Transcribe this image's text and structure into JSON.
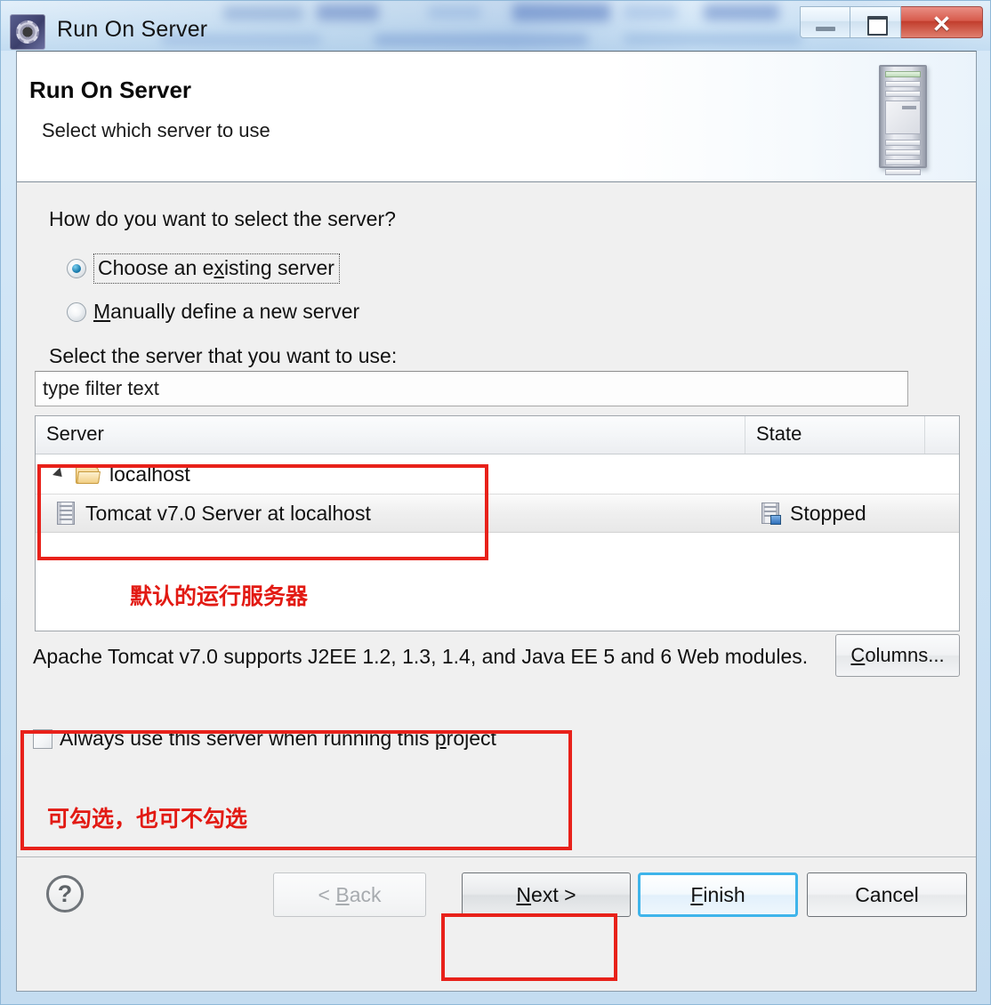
{
  "window": {
    "title": "Run On Server",
    "app_icon": "gear-icon",
    "controls": {
      "minimize": "minimize-icon",
      "maximize": "maximize-icon",
      "close": "✕"
    }
  },
  "header": {
    "title": "Run On Server",
    "subtitle": "Select which server to use",
    "graphic": "server-tower-icon"
  },
  "content": {
    "question": "How do you want to select the server?",
    "radios": [
      {
        "label_pre": "Choose an e",
        "mnemonic": "x",
        "label_post": "isting server",
        "checked": true,
        "focused": true
      },
      {
        "label_pre": "",
        "mnemonic": "M",
        "label_post": "anually define a new server",
        "checked": false,
        "focused": false
      }
    ],
    "select_label": "Select the server that you want to use:",
    "filter": {
      "value": "type filter text",
      "placeholder": "type filter text"
    },
    "tree": {
      "columns": [
        "Server",
        "State",
        ""
      ],
      "rows": [
        {
          "name": "localhost",
          "state": "",
          "icon": "folder-open-icon",
          "level": 0,
          "expanded": true,
          "selected": false
        },
        {
          "name": "Tomcat v7.0 Server at localhost",
          "state": "Stopped",
          "icon": "server-icon",
          "state_icon": "server-stopped-icon",
          "level": 1,
          "expanded": false,
          "selected": true
        }
      ]
    },
    "description": "Apache Tomcat v7.0 supports J2EE 1.2, 1.3, 1.4, and Java EE 5 and 6 Web modules.",
    "columns_button": {
      "mnemonic": "C",
      "label_post": "olumns..."
    },
    "checkbox": {
      "checked": false,
      "label_pre": "Always use this server when running this ",
      "mnemonic": "p",
      "label_post": "roject"
    }
  },
  "annotations": [
    {
      "id": "default-server",
      "text": "默认的运行服务器",
      "color": "#e21a13"
    },
    {
      "id": "checkbox-optional",
      "text": "可勾选，也可不勾选",
      "color": "#e21a13"
    }
  ],
  "highlight_boxes": [
    {
      "id": "tree-highlight",
      "target": "server-tree-rows",
      "color": "#e8211a"
    },
    {
      "id": "checkbox-highlight",
      "target": "always-use-checkbox",
      "color": "#e8211a"
    },
    {
      "id": "next-highlight",
      "target": "next-button",
      "color": "#e8211a"
    }
  ],
  "footer": {
    "help": "?",
    "buttons": [
      {
        "id": "back",
        "pre": "< ",
        "mnemonic": "B",
        "post": "ack",
        "enabled": false,
        "default": false
      },
      {
        "id": "next",
        "pre": "",
        "mnemonic": "N",
        "post": "ext >",
        "enabled": true,
        "default": false
      },
      {
        "id": "finish",
        "pre": "",
        "mnemonic": "F",
        "post": "inish",
        "enabled": true,
        "default": true
      },
      {
        "id": "cancel",
        "pre": "Ca",
        "mnemonic": "",
        "post": "ncel",
        "enabled": true,
        "default": false
      }
    ]
  }
}
